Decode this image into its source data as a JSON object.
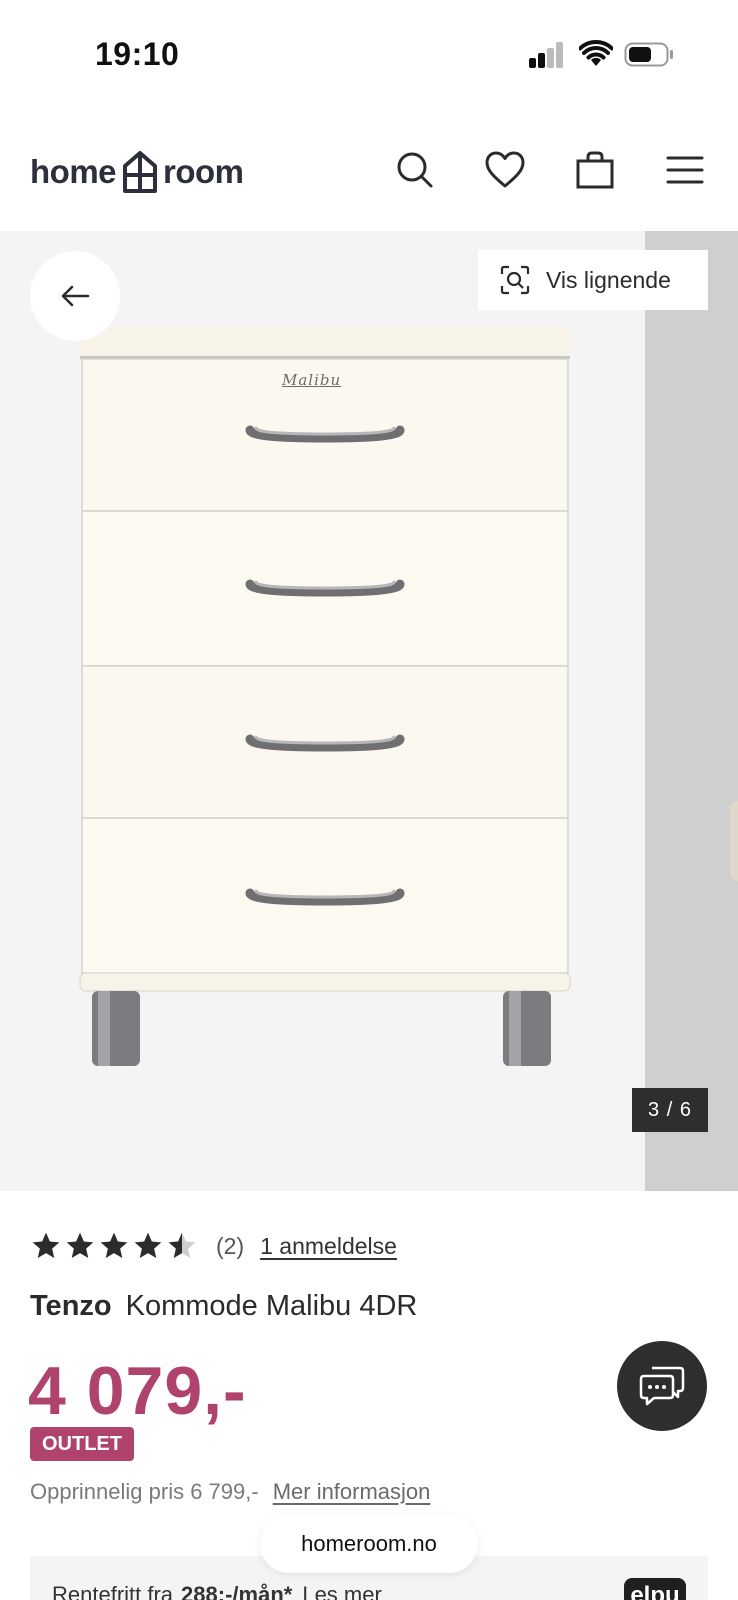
{
  "status_bar": {
    "time": "19:10"
  },
  "header": {
    "logo_left": "home",
    "logo_right": "room",
    "icons": [
      "search-icon",
      "heart-icon",
      "bag-icon",
      "menu-icon"
    ]
  },
  "gallery": {
    "similar_label": "Vis lignende",
    "counter": "3 / 6",
    "product_brand_mark": "Malibu"
  },
  "product": {
    "rating": 4.5,
    "rating_count": "(2)",
    "review_link": "1 anmeldelse",
    "brand": "Tenzo",
    "name": "Kommode Malibu 4DR",
    "price": "4 079,-",
    "badge": "OUTLET",
    "original_price": "Opprinnelig pris 6 799,-",
    "more_info": "Mer informasjon"
  },
  "finance": {
    "prefix": "Rentefritt fra",
    "amount": "288;-/mån*",
    "read_more": "Les mer",
    "provider": "elpu"
  },
  "browser": {
    "url": "homeroom.no"
  },
  "colors": {
    "accent": "#b0436e",
    "dark": "#2e2e2e",
    "gallery_bg": "#f4f4f4"
  }
}
